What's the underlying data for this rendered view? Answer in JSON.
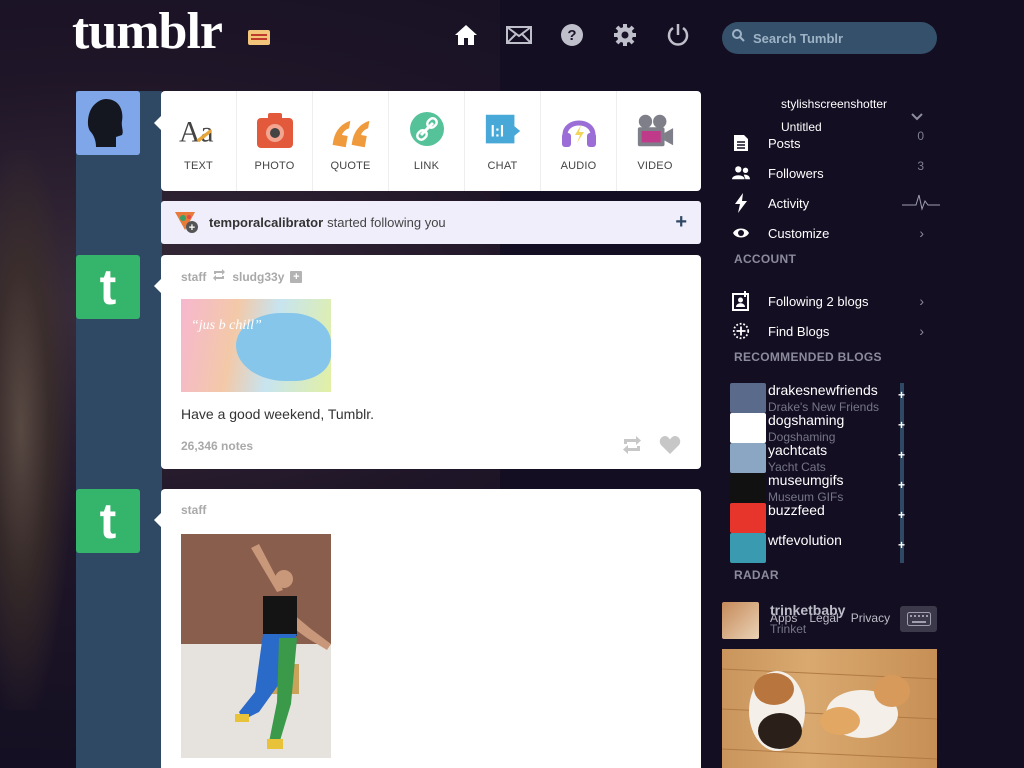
{
  "header": {
    "logo": "tumblr",
    "search_placeholder": "Search Tumblr",
    "nav": [
      "home-icon",
      "mail-icon",
      "help-icon",
      "gear-icon",
      "power-icon"
    ]
  },
  "composer": {
    "types": [
      {
        "label": "TEXT",
        "icon": "text-icon"
      },
      {
        "label": "PHOTO",
        "icon": "photo-icon"
      },
      {
        "label": "QUOTE",
        "icon": "quote-icon"
      },
      {
        "label": "LINK",
        "icon": "link-icon"
      },
      {
        "label": "CHAT",
        "icon": "chat-icon"
      },
      {
        "label": "AUDIO",
        "icon": "audio-icon"
      },
      {
        "label": "VIDEO",
        "icon": "video-icon"
      }
    ]
  },
  "notification": {
    "user": "temporalcalibrator",
    "text": "started following you"
  },
  "posts": [
    {
      "author": "staff",
      "reblogged_from": "sludg33y",
      "image_caption": "“jus b chill”",
      "body": "Have a good weekend, Tumblr.",
      "notes": "26,346 notes"
    },
    {
      "author": "staff"
    }
  ],
  "sidebar": {
    "blog_name": "stylishscreenshotter",
    "blog_title": "Untitled",
    "items": [
      {
        "label": "Posts",
        "count": "0",
        "icon": "posts-icon"
      },
      {
        "label": "Followers",
        "count": "3",
        "icon": "followers-icon"
      },
      {
        "label": "Activity",
        "icon": "activity-icon"
      },
      {
        "label": "Customize",
        "icon": "eye-icon"
      }
    ],
    "account_head": "ACCOUNT",
    "account_items": [
      {
        "label": "Following 2 blogs",
        "icon": "following-icon"
      },
      {
        "label": "Find Blogs",
        "icon": "find-blogs-icon"
      }
    ],
    "recommended_head": "RECOMMENDED BLOGS",
    "recommended": [
      {
        "name": "drakesnewfriends",
        "title": "Drake's New Friends",
        "color": "#5a6a8a"
      },
      {
        "name": "dogshaming",
        "title": "Dogshaming",
        "color": "#ffffff"
      },
      {
        "name": "yachtcats",
        "title": "Yacht Cats",
        "color": "#8aa6c2"
      },
      {
        "name": "museumgifs",
        "title": "Museum GIFs",
        "color": "#111111"
      },
      {
        "name": "buzzfeed",
        "title": "",
        "color": "#e8352b"
      },
      {
        "name": "wtfevolution",
        "title": "",
        "color": "#3a9bb0"
      }
    ],
    "radar_head": "RADAR",
    "radar": {
      "name": "trinketbaby",
      "title": "Trinket"
    },
    "footer_links": [
      "Apps",
      "Legal",
      "Privacy"
    ]
  }
}
